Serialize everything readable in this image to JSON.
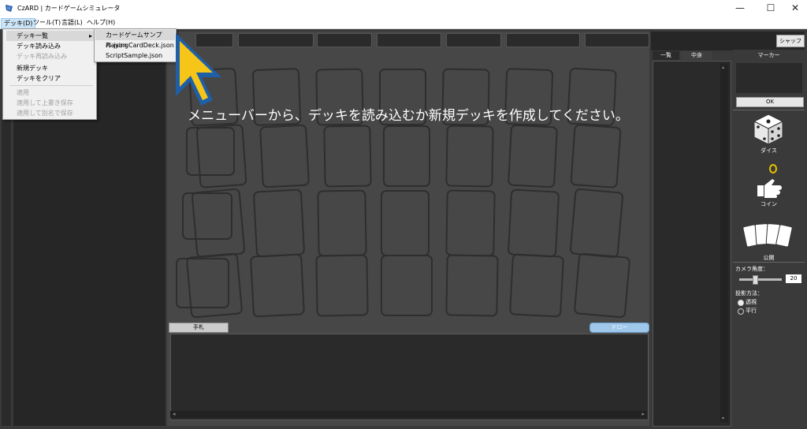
{
  "window": {
    "title": "CzARD | カードゲームシミュレータ",
    "minimize": "—",
    "maximize": "☐",
    "close": "✕"
  },
  "menubar": {
    "items": [
      "デッキ(D)",
      "ツール(T)",
      "言語(L)",
      "ヘルプ(H)"
    ]
  },
  "deck_menu": {
    "items": [
      {
        "label": "デッキ一覧",
        "enabled": true,
        "submenu": true
      },
      {
        "label": "デッキ読み込み",
        "enabled": true
      },
      {
        "label": "デッキ再読み込み",
        "enabled": false
      },
      {
        "label": "新規デッキ",
        "enabled": true
      },
      {
        "label": "デッキをクリア",
        "enabled": true
      },
      {
        "label": "適用",
        "enabled": false
      },
      {
        "label": "適用して上書き保存",
        "enabled": false
      },
      {
        "label": "適用して別名で保存",
        "enabled": false
      }
    ],
    "submenu_arrow": "▸"
  },
  "deck_submenu": {
    "items": [
      "カードゲームサンプル.json",
      "PlayingCardDeck.json",
      "ScriptSample.json"
    ]
  },
  "main": {
    "message": "メニューバーから、デッキを読み込むか新規デッキを作成してください。",
    "hand_tab": "手札",
    "draw_button": "ドロー",
    "shuffle_button": "シャッフル"
  },
  "list_tabs": [
    "一覧",
    "中身"
  ],
  "right_panel": {
    "marker_title": "マーカー",
    "ok_button": "OK",
    "dice_label": "ダイス",
    "coin_label": "コイン",
    "reveal_label": "公開",
    "camera_angle_label": "カメラ角度：",
    "camera_angle_value": "20",
    "camera_angle_fraction": 0.3,
    "projection_label": "投影方法：",
    "projection_options": [
      "透視",
      "平行"
    ],
    "projection_selected": "透視"
  },
  "colors": {
    "accent_arrow": "#f5c518",
    "arrow_outline": "#1f5fa8",
    "draw_button": "#9ec7ea",
    "menu_highlight": "#cce4f7"
  },
  "icons": {
    "dice": "dice-icon",
    "coin": "coin-flip-icon",
    "cards": "cards-fan-icon",
    "pointer": "pointer-arrow-icon"
  }
}
